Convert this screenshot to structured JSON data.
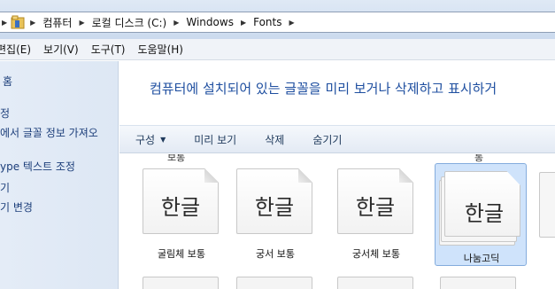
{
  "address": {
    "crumbs": [
      "컴퓨터",
      "로컬 디스크 (C:)",
      "Windows",
      "Fonts"
    ]
  },
  "menu": {
    "items": [
      "편집(E)",
      "보기(V)",
      "도구(T)",
      "도움말(H)"
    ]
  },
  "nav": {
    "items": [
      "홈",
      "정",
      "에서 글꼴 정보 가져오",
      "ype 텍스트 조정",
      "기",
      "기 변경"
    ]
  },
  "main": {
    "headline": "컴퓨터에 설치되어 있는 글꼴을 미리 보거나 삭제하고 표시하거",
    "commands": {
      "organize": "구성",
      "preview": "미리 보기",
      "delete": "삭제",
      "hide": "숨기기"
    },
    "cut_labels": [
      "보통",
      "통"
    ],
    "fonts": [
      {
        "sample": "한글",
        "label": "굴림체 보통"
      },
      {
        "sample": "한글",
        "label": "궁서 보통"
      },
      {
        "sample": "한글",
        "label": "궁서체 보통"
      },
      {
        "sample": "한글",
        "label": "나눔고딕"
      }
    ]
  },
  "colors": {
    "headline": "#1f4fa0",
    "nav_text": "#1c3e7a",
    "selection": "#cfe3fb"
  }
}
